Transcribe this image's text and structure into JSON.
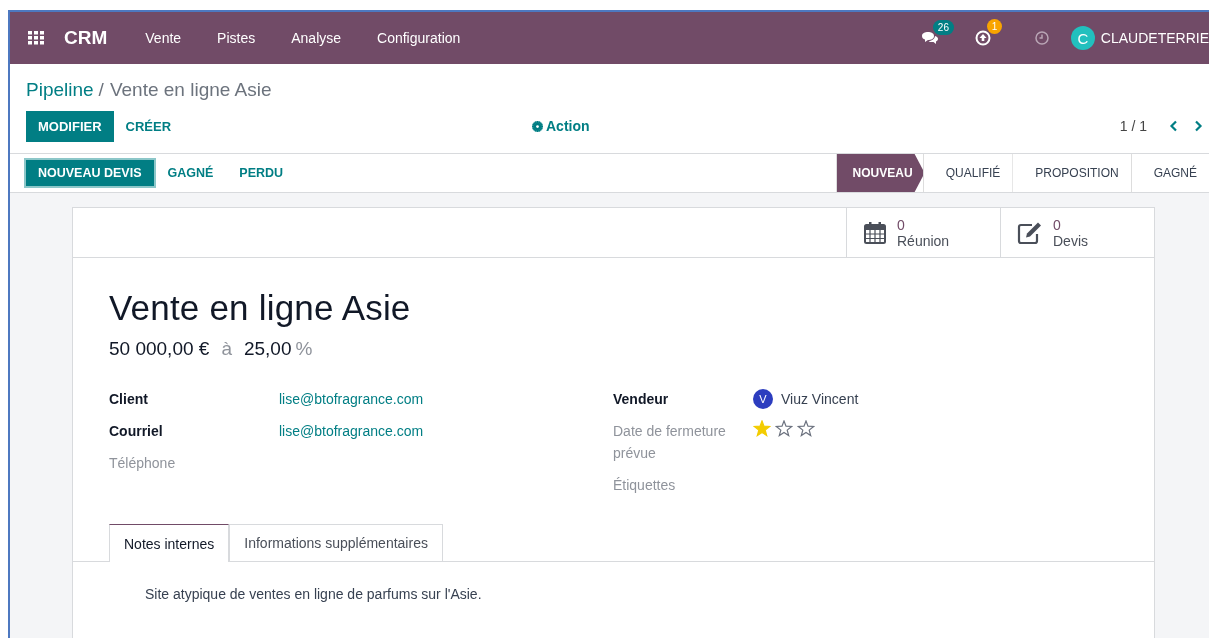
{
  "navbar": {
    "app": "CRM",
    "menu": [
      "Vente",
      "Pistes",
      "Analyse",
      "Configuration"
    ],
    "messages_badge": "26",
    "activity_badge": "1",
    "user_initial": "C",
    "user_name": "CLAUDETERRIE"
  },
  "breadcrumb": {
    "parent": "Pipeline",
    "separator": "/",
    "current": "Vente en ligne Asie"
  },
  "buttons": [
    {
      "label": "MODIFIER",
      "primary": true
    },
    {
      "label": "CRÉER",
      "primary": false
    }
  ],
  "action": "Action",
  "pager": "1 / 1",
  "header_buttons": [
    {
      "label": "NOUVEAU DEVIS",
      "primary": true
    },
    {
      "label": "GAGNÉ",
      "primary": false
    },
    {
      "label": "PERDU",
      "primary": false
    }
  ],
  "stages": [
    {
      "label": "NOUVEAU",
      "selected": true
    },
    {
      "label": "QUALIFIÉ",
      "selected": false
    },
    {
      "label": "PROPOSITION",
      "selected": false
    },
    {
      "label": "GAGNÉ",
      "selected": false
    }
  ],
  "smart_buttons": [
    {
      "kind": "calendar",
      "count": "0",
      "label": "Réunion"
    },
    {
      "kind": "edit",
      "count": "0",
      "label": "Devis"
    }
  ],
  "title": "Vente en ligne Asie",
  "revenue": "50 000,00 €",
  "at": "à",
  "probability": "25,00",
  "percent": "%",
  "left_fields": [
    {
      "label": "Client",
      "required": true,
      "value": "lise@btofragrance.com"
    },
    {
      "label": "Courriel",
      "required": true,
      "value": "lise@btofragrance.com"
    },
    {
      "label": "Téléphone",
      "required": false
    }
  ],
  "right_fields": [
    {
      "kind": "user",
      "label": "Vendeur",
      "required": true,
      "initial": "V",
      "value": "Viuz Vincent"
    },
    {
      "kind": "priority",
      "label": "Date de fermeture prévue",
      "required": false,
      "stars": 1
    },
    {
      "kind": "empty",
      "label": "Étiquettes",
      "required": false
    }
  ],
  "tabs": [
    {
      "label": "Notes internes",
      "selected": true
    },
    {
      "label": "Informations supplémentaires",
      "selected": false
    }
  ],
  "note": "Site atypique de ventes en ligne de parfums sur l'Asie."
}
